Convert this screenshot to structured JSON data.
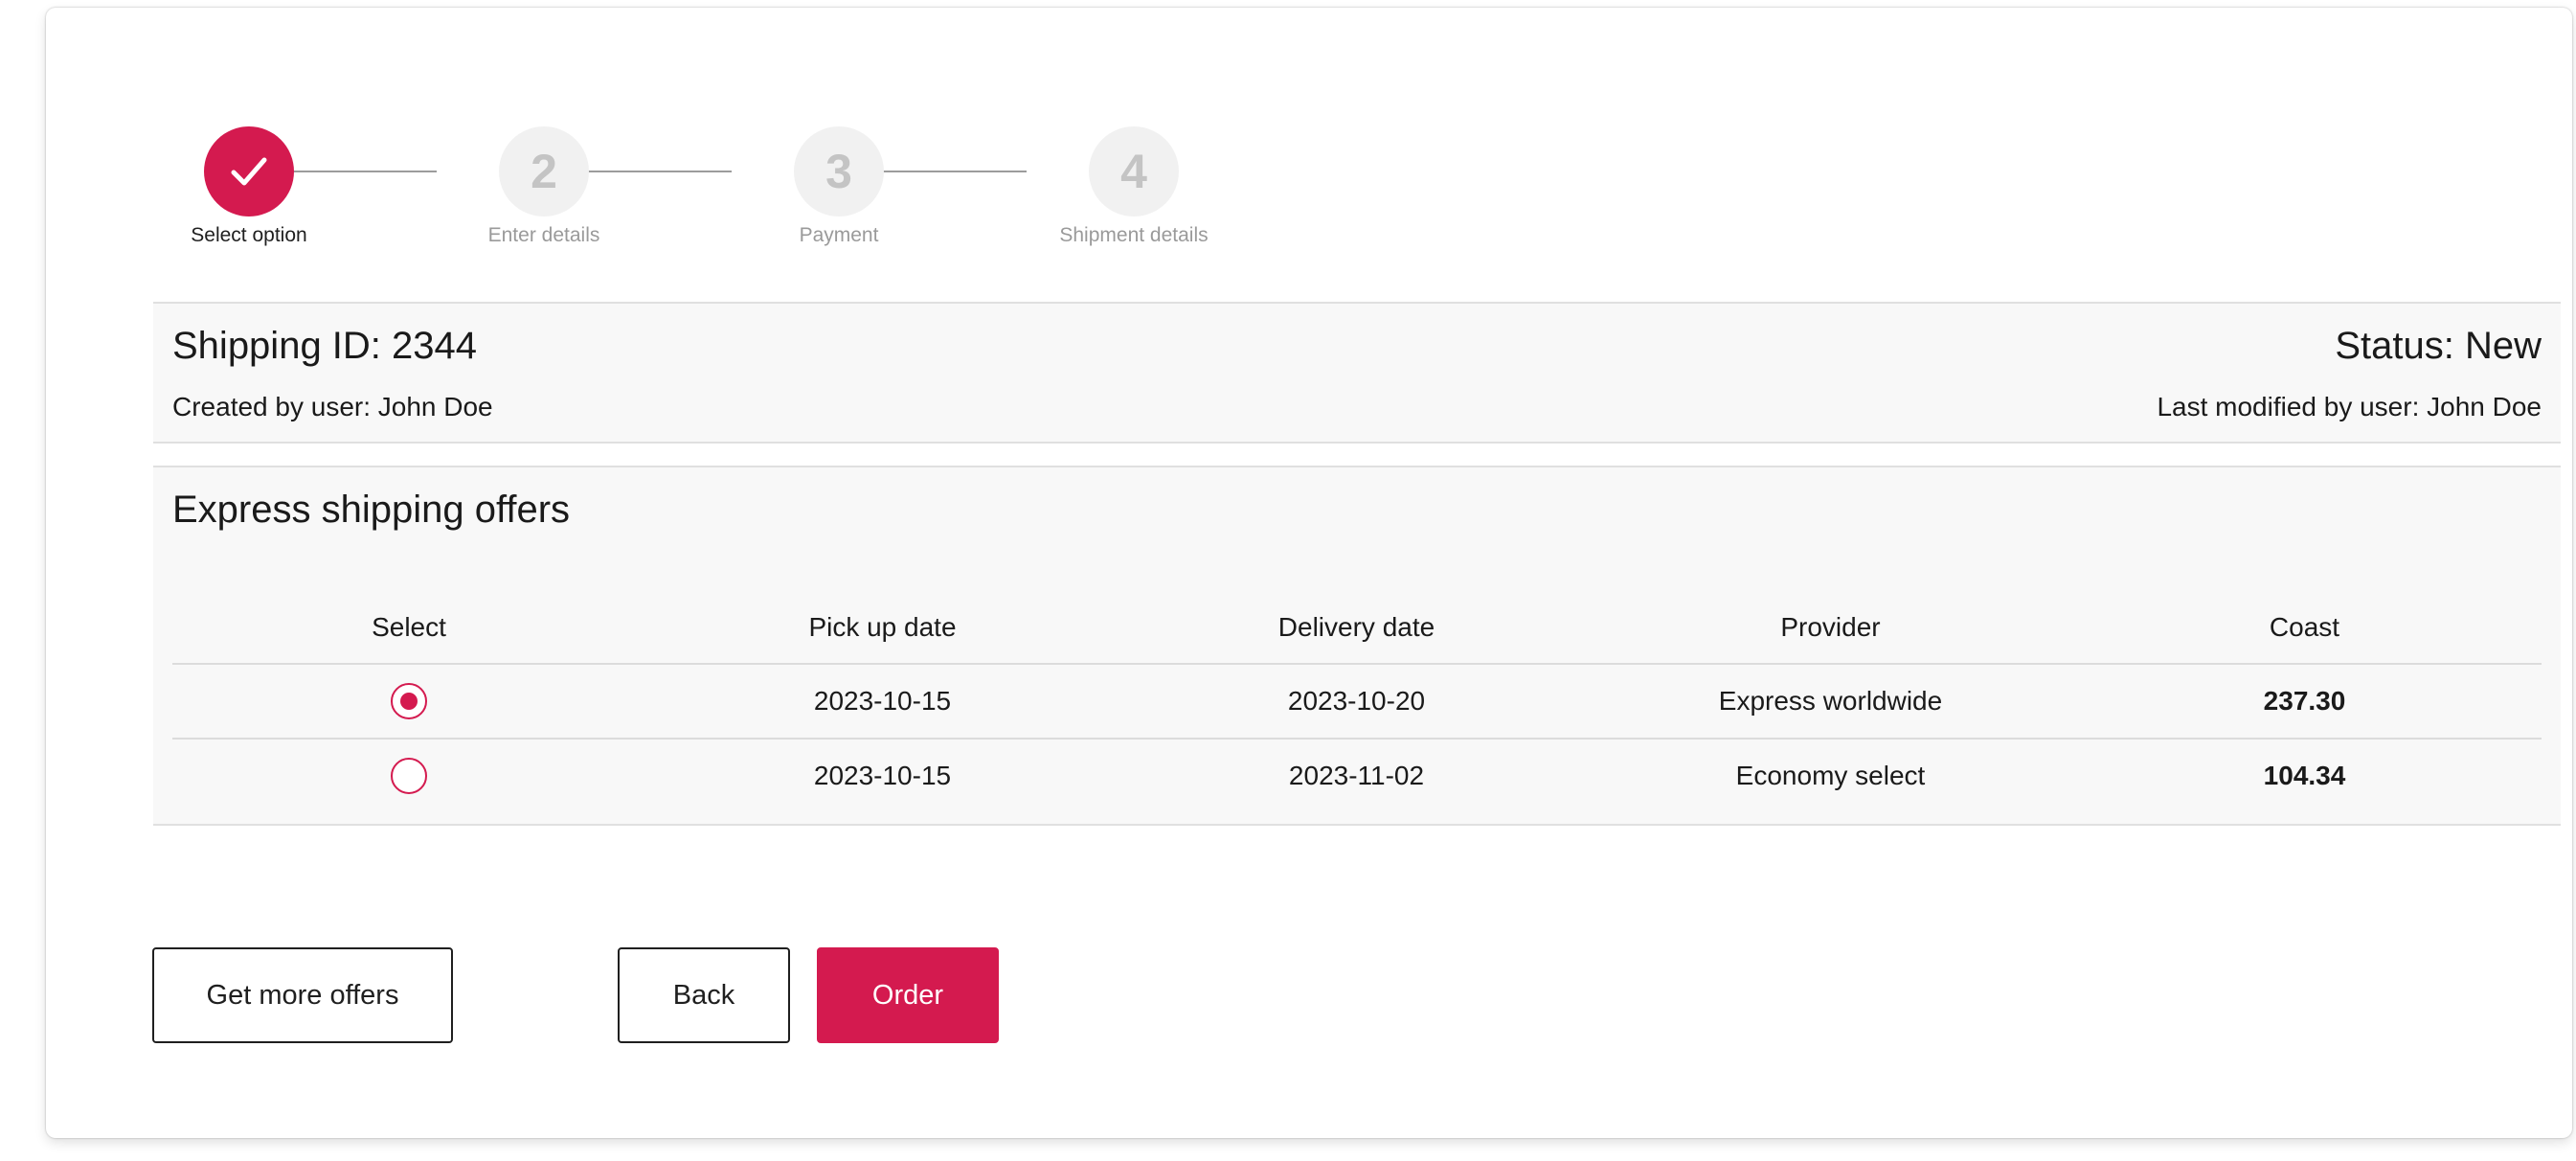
{
  "stepper": {
    "steps": [
      {
        "number": "",
        "label": "Select option",
        "state": "completed"
      },
      {
        "number": "2",
        "label": "Enter details",
        "state": "pending"
      },
      {
        "number": "3",
        "label": "Payment",
        "state": "pending"
      },
      {
        "number": "4",
        "label": "Shipment details",
        "state": "pending"
      }
    ]
  },
  "header": {
    "shipping_id": "Shipping ID: 2344",
    "created_by": "Created by user: John Doe",
    "status": "Status: New",
    "modified_by": "Last modified by user: John Doe"
  },
  "offers": {
    "title": "Express shipping offers",
    "columns": [
      "Select",
      "Pick up date",
      "Delivery date",
      "Provider",
      "Coast"
    ],
    "rows": [
      {
        "selected": true,
        "pickup": "2023-10-15",
        "delivery": "2023-10-20",
        "provider": "Express worldwide",
        "cost": "237.30"
      },
      {
        "selected": false,
        "pickup": "2023-10-15",
        "delivery": "2023-11-02",
        "provider": "Economy select",
        "cost": "104.34"
      }
    ]
  },
  "actions": {
    "more_offers_label": "Get more offers",
    "back_label": "Back",
    "order_label": "Order"
  },
  "colors": {
    "accent": "#d41a4f",
    "panel_bg": "#f8f8f8",
    "pending_step_bg": "#f1f1f1"
  },
  "icons": {
    "completed_step": "check-icon"
  }
}
